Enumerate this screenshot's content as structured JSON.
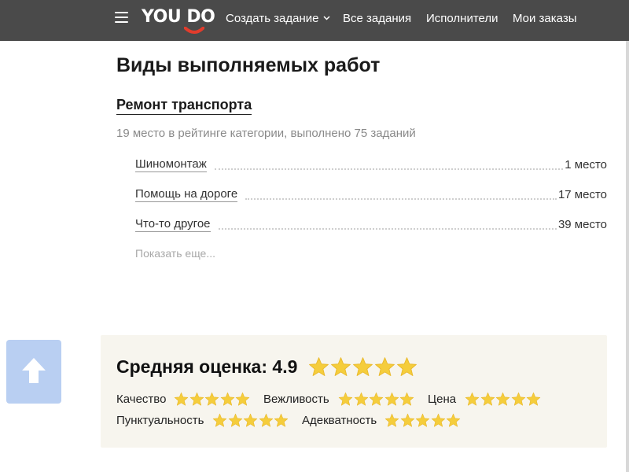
{
  "header": {
    "logo_text": "YOU DO",
    "nav": [
      {
        "label": "Создать задание"
      },
      {
        "label": "Все задания"
      },
      {
        "label": "Исполнители"
      },
      {
        "label": "Мои заказы"
      }
    ]
  },
  "main": {
    "title": "Виды выполняемых работ",
    "category": {
      "name": "Ремонт транспорта",
      "info": "19 место в рейтинге категории, выполнено 75 заданий",
      "works": [
        {
          "name": "Шиномонтаж",
          "place": "1 место"
        },
        {
          "name": "Помощь на дороге",
          "place": "17 место"
        },
        {
          "name": "Что-то другое",
          "place": "39 место"
        }
      ],
      "show_more": "Показать еще..."
    }
  },
  "rating": {
    "title": "Средняя оценка: 4.9",
    "average": 4.9,
    "criteria": [
      {
        "label": "Качество",
        "stars": 5
      },
      {
        "label": "Вежливость",
        "stars": 5
      },
      {
        "label": "Цена",
        "stars": 5
      },
      {
        "label": "Пунктуальность",
        "stars": 5
      },
      {
        "label": "Адекватность",
        "stars": 5
      }
    ]
  },
  "colors": {
    "header_bg": "#4a4a4a",
    "logo_smile": "#e23c2c",
    "star": "#f5cd3c",
    "card_bg": "#f7f5ee",
    "up_button": "#b9cff2"
  }
}
